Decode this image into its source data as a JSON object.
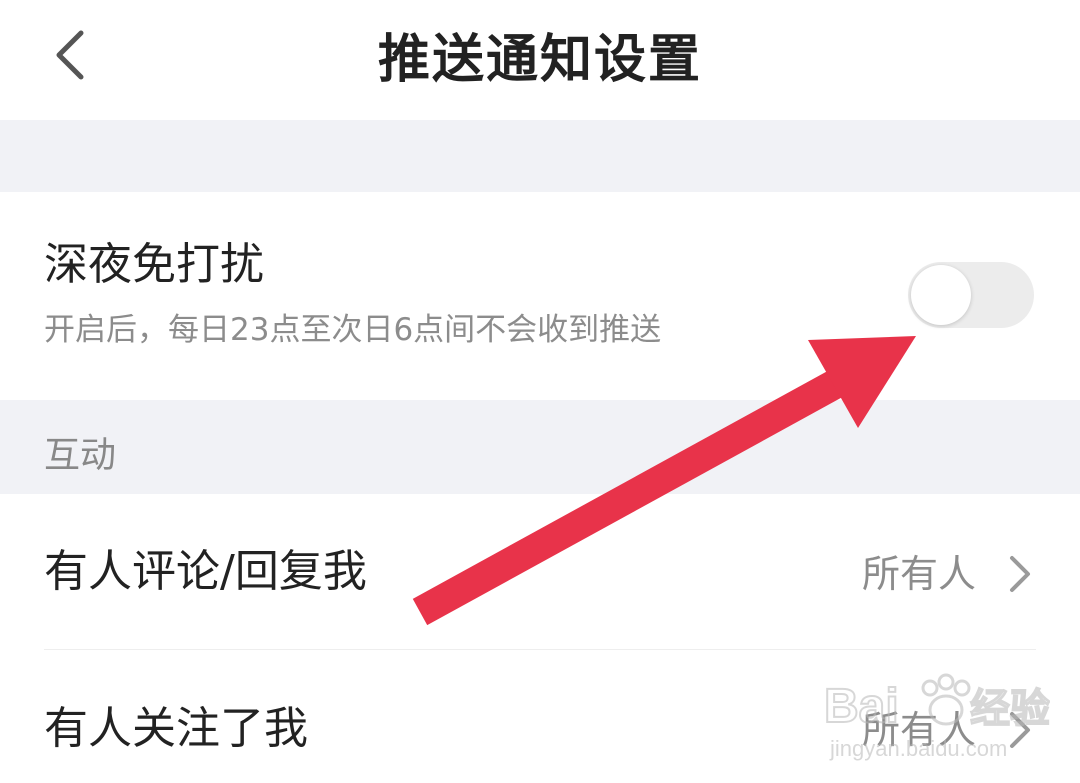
{
  "header": {
    "title": "推送通知设置",
    "back_icon": "chevron-left-icon"
  },
  "night_mode": {
    "title": "深夜免打扰",
    "description": "开启后，每日23点至次日6点间不会收到推送",
    "enabled": false
  },
  "sections": [
    {
      "label": "互动",
      "rows": [
        {
          "label": "有人评论/回复我",
          "value": "所有人"
        },
        {
          "label": "有人关注了我",
          "value": "所有人"
        }
      ]
    }
  ],
  "annotation": {
    "type": "arrow",
    "color": "#e8334a",
    "points_to": "night-mode-toggle"
  },
  "watermark": {
    "text": "Bai经验",
    "sub": "jingyan.baidu.com"
  },
  "colors": {
    "background": "#ffffff",
    "section_bg": "#f1f2f6",
    "primary_text": "#222222",
    "secondary_text": "#8c8c8c",
    "toggle_off": "#ececec",
    "arrow": "#e8334a"
  }
}
